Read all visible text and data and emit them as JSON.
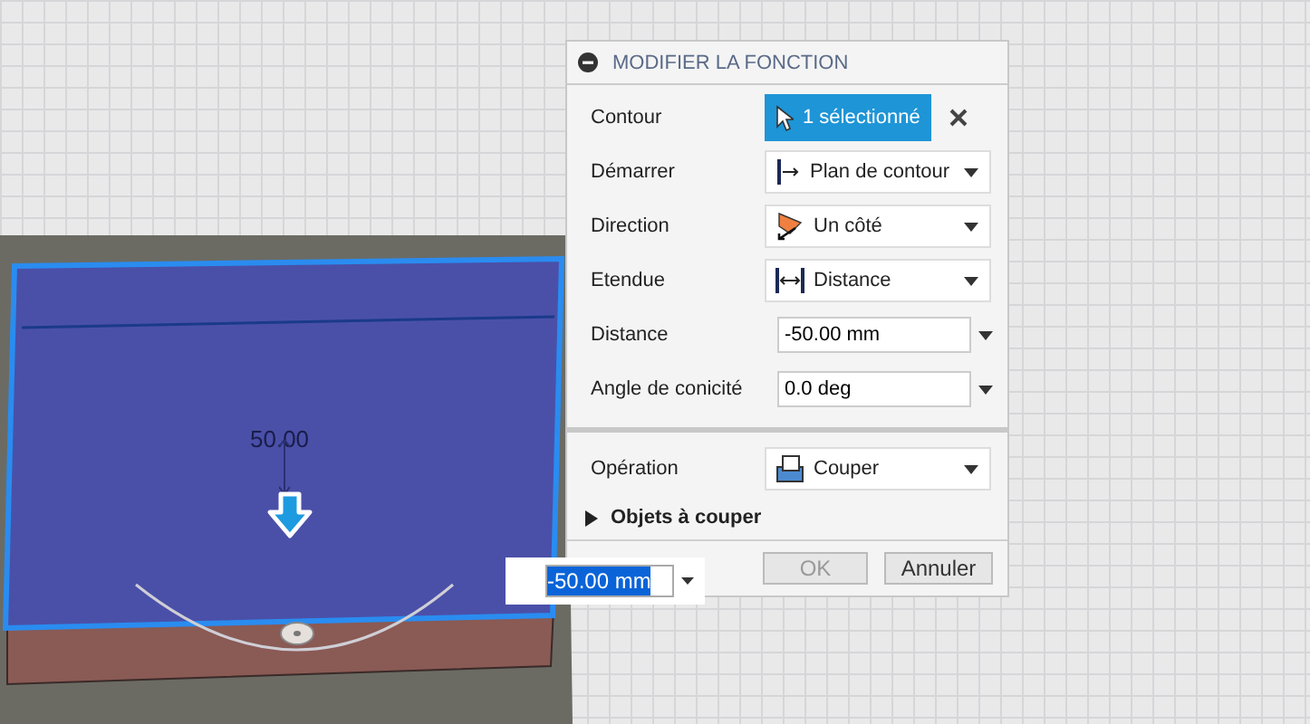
{
  "viewport": {
    "dimension_label": "50.00",
    "inline_input": {
      "value": "-50.00 mm",
      "selected": true
    }
  },
  "dialog": {
    "title": "MODIFIER LA FONCTION",
    "rows": [
      {
        "kind": "selection",
        "label": "Contour",
        "value": "1 sélectionné"
      },
      {
        "kind": "dropdown",
        "label": "Démarrer",
        "value": "Plan de contour"
      },
      {
        "kind": "dropdown",
        "label": "Direction",
        "value": "Un côté"
      },
      {
        "kind": "dropdown",
        "label": "Etendue",
        "value": "Distance"
      },
      {
        "kind": "input",
        "label": "Distance",
        "value": "-50.00 mm"
      },
      {
        "kind": "input",
        "label": "Angle de conicité",
        "value": "0.0 deg"
      },
      {
        "kind": "divider"
      },
      {
        "kind": "dropdown",
        "label": "Opération",
        "value": "Couper"
      },
      {
        "kind": "section",
        "label": "Objets à couper",
        "expanded": false
      }
    ],
    "buttons": [
      {
        "label": "OK",
        "disabled": true
      },
      {
        "label": "Annuler",
        "disabled": false
      }
    ]
  }
}
